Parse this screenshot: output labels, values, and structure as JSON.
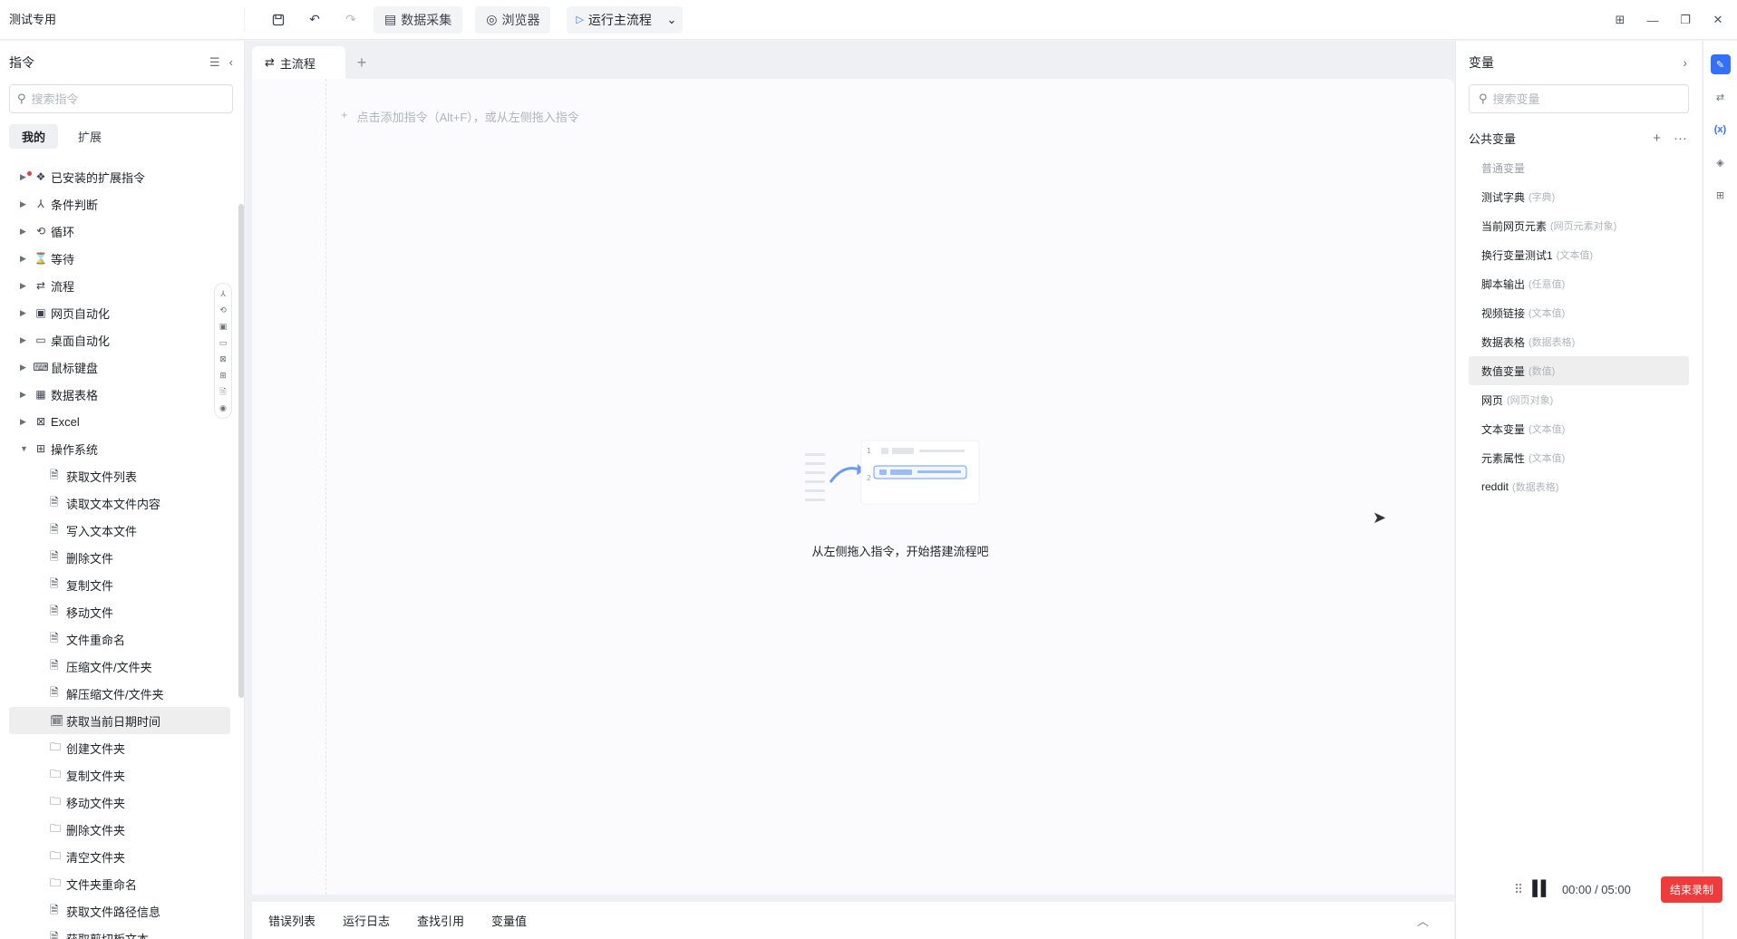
{
  "app": {
    "title": "测试专用"
  },
  "toolbar": {
    "data_collect_label": "数据采集",
    "browser_label": "浏览器",
    "run_label": "运行主流程"
  },
  "left_panel": {
    "title": "指令",
    "search_placeholder": "搜索指令",
    "tabs": [
      {
        "label": "我的"
      },
      {
        "label": "扩展"
      }
    ],
    "categories": [
      {
        "label": "已安装的扩展指令",
        "icon": "extension-icon"
      },
      {
        "label": "条件判断",
        "icon": "branch-icon"
      },
      {
        "label": "循环",
        "icon": "loop-icon"
      },
      {
        "label": "等待",
        "icon": "hourglass-icon"
      },
      {
        "label": "流程",
        "icon": "flow-icon"
      },
      {
        "label": "网页自动化",
        "icon": "web-icon"
      },
      {
        "label": "桌面自动化",
        "icon": "desktop-icon"
      },
      {
        "label": "鼠标键盘",
        "icon": "keyboard-icon"
      },
      {
        "label": "数据表格",
        "icon": "table-icon"
      },
      {
        "label": "Excel",
        "icon": "excel-icon"
      },
      {
        "label": "操作系统",
        "icon": "os-icon"
      }
    ],
    "os_children": [
      {
        "label": "获取文件列表"
      },
      {
        "label": "读取文本文件内容"
      },
      {
        "label": "写入文本文件"
      },
      {
        "label": "删除文件"
      },
      {
        "label": "复制文件"
      },
      {
        "label": "移动文件"
      },
      {
        "label": "文件重命名"
      },
      {
        "label": "压缩文件/文件夹"
      },
      {
        "label": "解压缩文件/文件夹"
      },
      {
        "label": "获取当前日期时间"
      },
      {
        "label": "创建文件夹"
      },
      {
        "label": "复制文件夹"
      },
      {
        "label": "移动文件夹"
      },
      {
        "label": "删除文件夹"
      },
      {
        "label": "清空文件夹"
      },
      {
        "label": "文件夹重命名"
      },
      {
        "label": "获取文件路径信息"
      },
      {
        "label": "获取剪切板文本"
      }
    ]
  },
  "center": {
    "tab_label": "主流程",
    "add_hint": "点击添加指令（Alt+F），或从左侧拖入指令",
    "empty_text": "从左侧拖入指令，开始搭建流程吧",
    "bottom_tabs": [
      {
        "label": "错误列表"
      },
      {
        "label": "运行日志"
      },
      {
        "label": "查找引用"
      },
      {
        "label": "变量值"
      }
    ]
  },
  "right_panel": {
    "title": "变量",
    "search_placeholder": "搜索变量",
    "section_title": "公共变量",
    "variables": [
      {
        "name": "普通变量",
        "type": ""
      },
      {
        "name": "测试字典",
        "type": "(字典)"
      },
      {
        "name": "当前网页元素",
        "type": "(网页元素对象)"
      },
      {
        "name": "换行变量测试1",
        "type": "(文本值)"
      },
      {
        "name": "脚本输出",
        "type": "(任意值)"
      },
      {
        "name": "视频链接",
        "type": "(文本值)"
      },
      {
        "name": "数据表格",
        "type": "(数据表格)"
      },
      {
        "name": "数值变量",
        "type": "(数值)"
      },
      {
        "name": "网页",
        "type": "(网页对象)"
      },
      {
        "name": "文本变量",
        "type": "(文本值)"
      },
      {
        "name": "元素属性",
        "type": "(文本值)"
      },
      {
        "name": "reddit",
        "type": "(数据表格)"
      }
    ]
  },
  "recorder": {
    "time": "00:00 / 05:00",
    "stop_label": "结束录制"
  },
  "colors": {
    "accent": "#3370ff",
    "danger": "#ee3b3b"
  }
}
